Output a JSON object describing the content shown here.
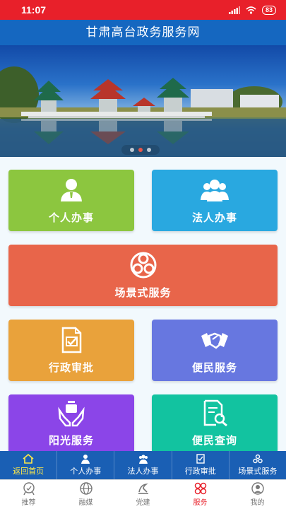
{
  "status_bar": {
    "time": "11:07",
    "battery": "83"
  },
  "header": {
    "title": "甘肃高台政务服务网"
  },
  "banner": {
    "slides": 3,
    "active_slide": 2
  },
  "tiles": [
    {
      "key": "personal",
      "label": "个人办事",
      "color": "#8cc63f",
      "icon": "person-icon"
    },
    {
      "key": "legal",
      "label": "法人办事",
      "color": "#29a8e0",
      "icon": "group-icon"
    },
    {
      "key": "scene",
      "label": "场景式服务",
      "color": "#e8654a",
      "icon": "scene-icon"
    },
    {
      "key": "admin",
      "label": "行政审批",
      "color": "#e9a23b",
      "icon": "document-check-icon"
    },
    {
      "key": "convenience",
      "label": "便民服务",
      "color": "#6777e0",
      "icon": "handshake-icon"
    },
    {
      "key": "sunshine",
      "label": "阳光服务",
      "color": "#8b45e8",
      "icon": "hands-icon"
    },
    {
      "key": "query",
      "label": "便民查询",
      "color": "#12c3a0",
      "icon": "document-search-icon"
    }
  ],
  "quick_nav": [
    {
      "label": "返回首页",
      "icon": "home-icon"
    },
    {
      "label": "个人办事",
      "icon": "person-icon"
    },
    {
      "label": "法人办事",
      "icon": "group-icon"
    },
    {
      "label": "行政审批",
      "icon": "document-check-icon"
    },
    {
      "label": "场景式服务",
      "icon": "scene-icon"
    }
  ],
  "tabbar": [
    {
      "label": "推荐",
      "icon": "recommend-icon"
    },
    {
      "label": "融媒",
      "icon": "globe-icon"
    },
    {
      "label": "党建",
      "icon": "party-emblem-icon"
    },
    {
      "label": "服务",
      "icon": "grid-icon",
      "active": true
    },
    {
      "label": "我的",
      "icon": "user-icon"
    }
  ]
}
